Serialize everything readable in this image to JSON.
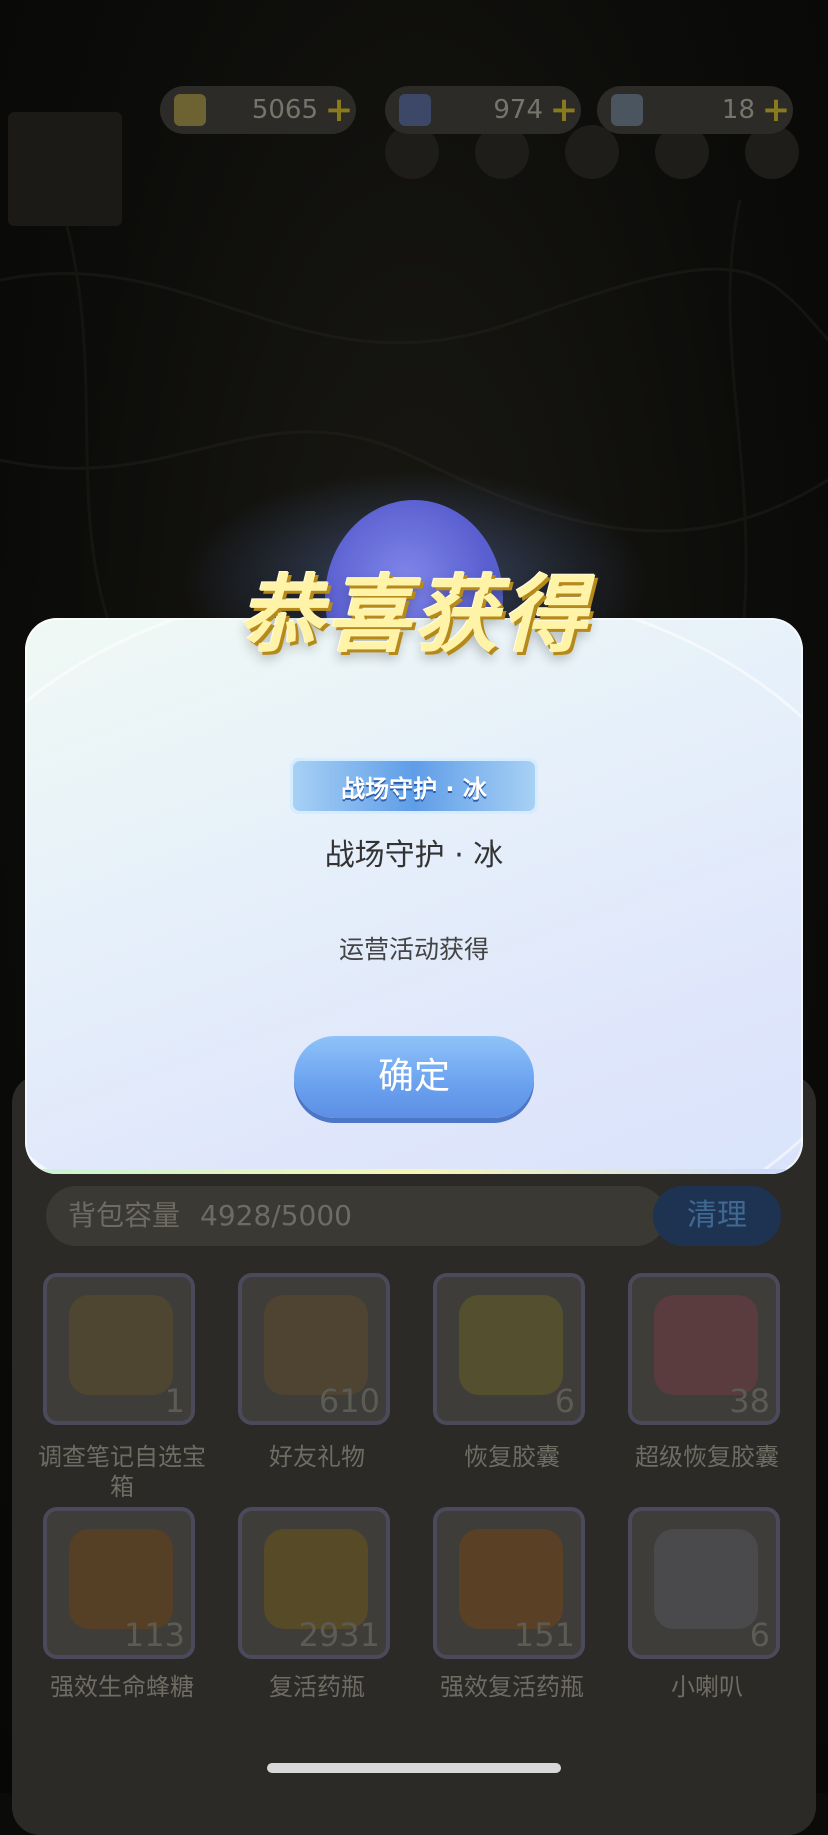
{
  "currencies": [
    {
      "name": "gold-coin",
      "value": "5065"
    },
    {
      "name": "diamond",
      "value": "974"
    },
    {
      "name": "ticket",
      "value": "18"
    }
  ],
  "modal": {
    "title": "恭喜获得",
    "tag_label": "战场守护 · 冰",
    "item_name": "战场守护 · 冰",
    "source": "运营活动获得",
    "confirm_label": "确定"
  },
  "inventory": {
    "capacity_label": "背包容量",
    "capacity_value": "4928/5000",
    "clean_label": "清理",
    "items": [
      {
        "name": "调查笔记自选宝箱",
        "count": "1"
      },
      {
        "name": "好友礼物",
        "count": "610"
      },
      {
        "name": "恢复胶囊",
        "count": "6"
      },
      {
        "name": "超级恢复胶囊",
        "count": "38"
      },
      {
        "name": "强效生命蜂糖",
        "count": "113"
      },
      {
        "name": "复活药瓶",
        "count": "2931"
      },
      {
        "name": "强效复活药瓶",
        "count": "151"
      },
      {
        "name": "小喇叭",
        "count": "6"
      }
    ]
  },
  "colors": {
    "accent_blue": "#6aa1ef",
    "title_gold": "#fff3a8",
    "overlay": "#0b0b0a"
  }
}
